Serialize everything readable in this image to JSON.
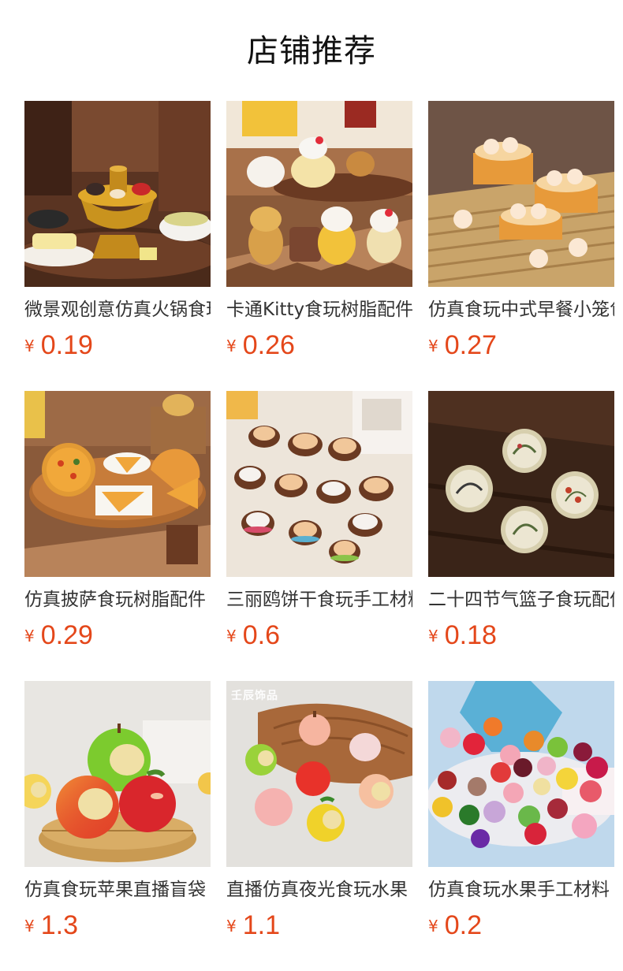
{
  "shop": {
    "title": "店铺推荐"
  },
  "currency_symbol": "¥",
  "accent_color": "#e4471a",
  "products": [
    {
      "name": "微景观创意仿真火锅食玩",
      "price": "0.19",
      "image": "hotpot-miniature-image"
    },
    {
      "name": "卡通Kitty食玩树脂配件",
      "price": "0.26",
      "image": "kitty-food-play-image"
    },
    {
      "name": "仿真食玩中式早餐小笼包",
      "price": "0.27",
      "image": "steamed-buns-basket-image"
    },
    {
      "name": "仿真披萨食玩树脂配件",
      "price": "0.29",
      "image": "pizza-miniature-image"
    },
    {
      "name": "三丽鸥饼干食玩手工材料",
      "price": "0.6",
      "image": "sanrio-cookies-image"
    },
    {
      "name": "二十四节气篮子食玩配件",
      "price": "0.18",
      "image": "solar-terms-plates-image"
    },
    {
      "name": "仿真食玩苹果直播盲袋",
      "price": "1.3",
      "image": "bitten-apples-image"
    },
    {
      "name": "直播仿真夜光食玩水果",
      "price": "1.1",
      "image": "glowing-fruit-image",
      "watermark": "壬辰饰品"
    },
    {
      "name": "仿真食玩水果手工材料",
      "price": "0.2",
      "image": "assorted-fruit-image"
    }
  ]
}
